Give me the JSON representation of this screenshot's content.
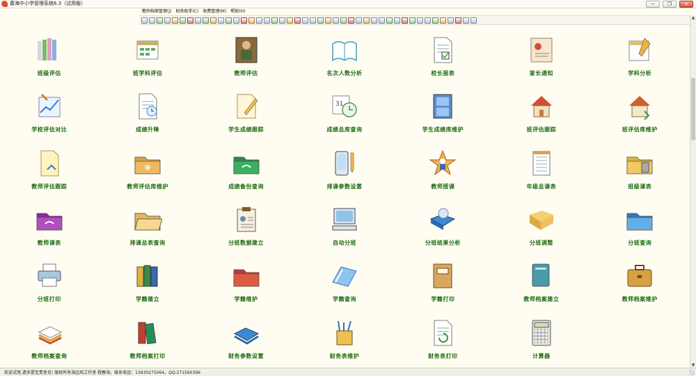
{
  "window": {
    "title": "春海中小学管理系统6.3（试用版）",
    "buttons": {
      "minimize": "─",
      "restore": "❐",
      "close": "✕"
    }
  },
  "menu": [
    "教师档案管理(J)",
    "财务助手(C)",
    "收费管理(M)",
    "帮助(H)"
  ],
  "toolbar_button_count": 44,
  "grid": [
    {
      "label": "班级评估",
      "icon": "book-stack-icon"
    },
    {
      "label": "班学科评估",
      "icon": "calendar-grid-icon"
    },
    {
      "label": "教师评估",
      "icon": "teacher-photo-icon"
    },
    {
      "label": "名次人数分析",
      "icon": "open-book-icon"
    },
    {
      "label": "校长报表",
      "icon": "checked-document-icon"
    },
    {
      "label": "家长通知",
      "icon": "notice-letter-icon"
    },
    {
      "label": "学科分析",
      "icon": "calendar-pencil-icon"
    },
    {
      "label": "学校评估对比",
      "icon": "chart-pencil-icon"
    },
    {
      "label": "成绩升降",
      "icon": "document-clock-icon"
    },
    {
      "label": "学生成绩跟踪",
      "icon": "pencil-paper-icon"
    },
    {
      "label": "成绩总库查询",
      "icon": "calendar-clock-icon"
    },
    {
      "label": "学生成绩库维护",
      "icon": "file-cabinet-icon"
    },
    {
      "label": "班评估跟踪",
      "icon": "house-icon"
    },
    {
      "label": "班评估库维护",
      "icon": "house-arrow-icon"
    },
    {
      "label": "教师评估跟踪",
      "icon": "document-arrow-icon"
    },
    {
      "label": "教师评估库维护",
      "icon": "orange-folder-icon"
    },
    {
      "label": "成绩备份查询",
      "icon": "green-folder-icon"
    },
    {
      "label": "排课参数设置",
      "icon": "device-pencil-icon"
    },
    {
      "label": "教师授课",
      "icon": "star-person-icon"
    },
    {
      "label": "年级总课表",
      "icon": "notepad-icon"
    },
    {
      "label": "班级课表",
      "icon": "folder-tools-icon"
    },
    {
      "label": "教师课表",
      "icon": "purple-folder-icon"
    },
    {
      "label": "排课总表查询",
      "icon": "open-folder-icon"
    },
    {
      "label": "分班数据建立",
      "icon": "clipboard-icon"
    },
    {
      "label": "自动分班",
      "icon": "computer-icon"
    },
    {
      "label": "分班结果分析",
      "icon": "blue-cd-folder-icon"
    },
    {
      "label": "分班调整",
      "icon": "yellow-folder-icon"
    },
    {
      "label": "分班查询",
      "icon": "blue-folder-icon"
    },
    {
      "label": "分班打印",
      "icon": "printer-icon"
    },
    {
      "label": "学籍建立",
      "icon": "binders-icon"
    },
    {
      "label": "学籍维护",
      "icon": "red-folder-icon"
    },
    {
      "label": "学籍查询",
      "icon": "light-blue-folder-icon"
    },
    {
      "label": "学籍打印",
      "icon": "archive-box-icon"
    },
    {
      "label": "教师档案建立",
      "icon": "teal-book-icon"
    },
    {
      "label": "教师档案维护",
      "icon": "briefcase-icon"
    },
    {
      "label": "教师档案查询",
      "icon": "notebook-stack-icon"
    },
    {
      "label": "教师档案打印",
      "icon": "red-green-books-icon"
    },
    {
      "label": "财务参数设置",
      "icon": "blue-folder-stack-icon"
    },
    {
      "label": "财务表维护",
      "icon": "pen-cup-icon"
    },
    {
      "label": "财务表打印",
      "icon": "document-refresh-icon"
    },
    {
      "label": "计算器",
      "icon": "calculator-icon"
    },
    {
      "label": "",
      "icon": ""
    }
  ],
  "status": {
    "text": "欢迎试用,请多提宝贵意见!  版权所有海边风工作室  程春海，联系电话：13930275064，QQ:271560396"
  },
  "colors": {
    "background": "#fffdf2",
    "label": "#1c6a12",
    "close_button": "#d8553d"
  }
}
